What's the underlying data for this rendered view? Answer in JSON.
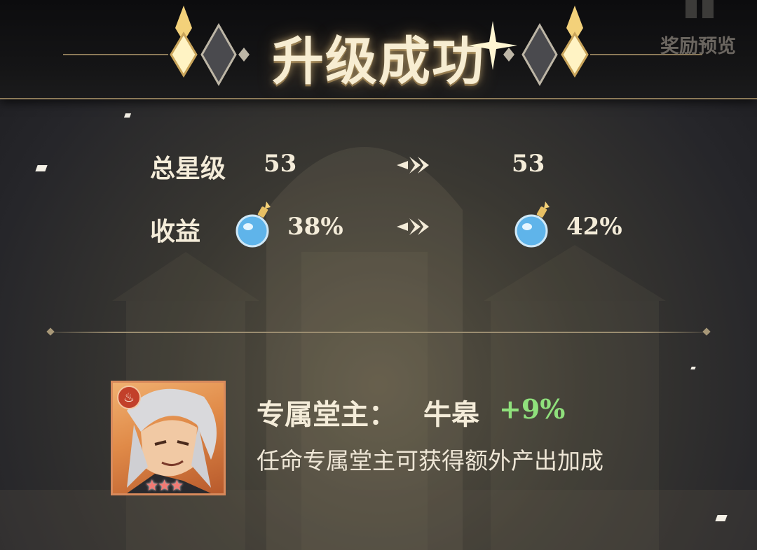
{
  "header": {
    "title": "升级成功",
    "preview_label": "奖励预览"
  },
  "stats": {
    "star_level": {
      "label": "总星级",
      "from": "53",
      "to": "53"
    },
    "income": {
      "label": "收益",
      "from": "38%",
      "to": "42%",
      "icon": "potion-icon"
    }
  },
  "keeper": {
    "title": "专属堂主：",
    "name": "牛皋",
    "bonus": "+9%",
    "description": "任命专属堂主可获得额外产出加成",
    "stars": "★★★",
    "element_icon": "fire-icon"
  },
  "colors": {
    "accent_gold": "#f7edd2",
    "bonus_green": "#8fe07c",
    "portrait_frame": "#d88a5c"
  }
}
